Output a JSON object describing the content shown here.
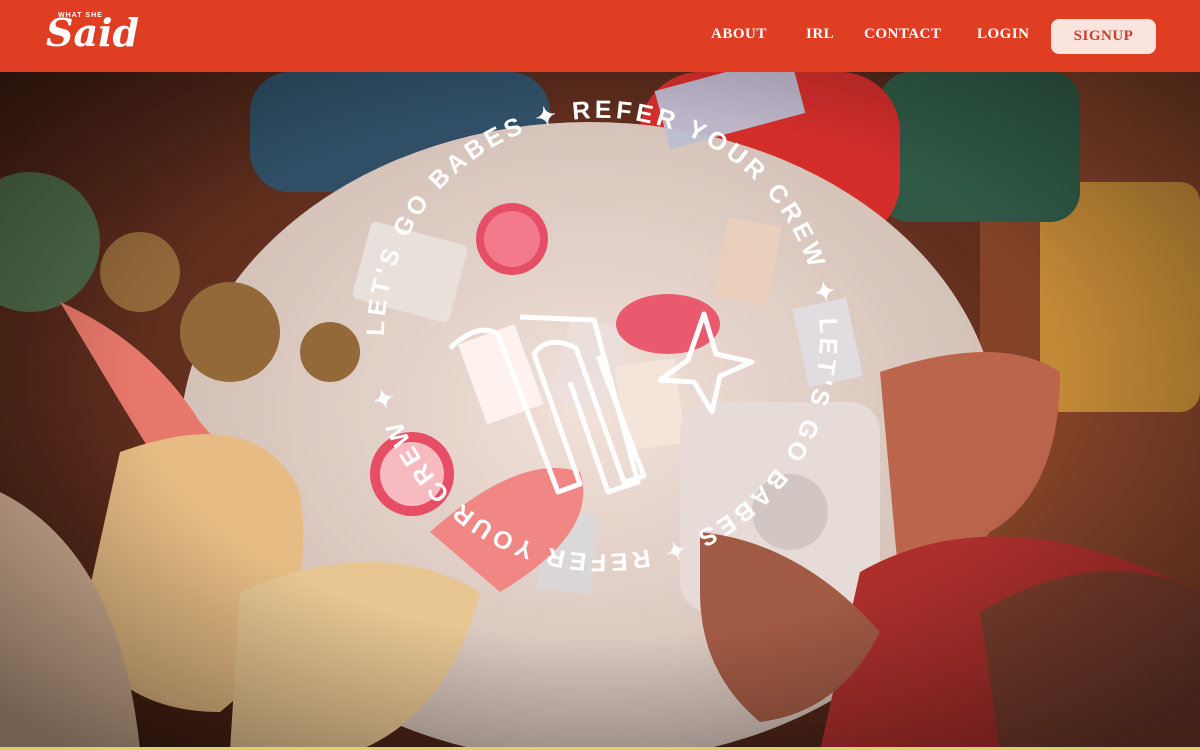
{
  "colors": {
    "nav_bg": "#e03e23",
    "signup_bg": "#fbe4de",
    "signup_text": "#c4402f",
    "badge_text": "#ffffff"
  },
  "logo": {
    "small_text": "WHAT SHE",
    "big_text": "Said"
  },
  "nav": {
    "about": "ABOUT",
    "irl": "IRL",
    "contact": "CONTACT",
    "login": "LOGIN",
    "signup": "SIGNUP"
  },
  "badge": {
    "ring_text": "LET'S GO BABES ✦ REFER YOUR CREW ✦ LET'S GO BABES ✦ REFER YOUR CREW ✦ ",
    "center_icon": "w-star-logo-icon"
  }
}
